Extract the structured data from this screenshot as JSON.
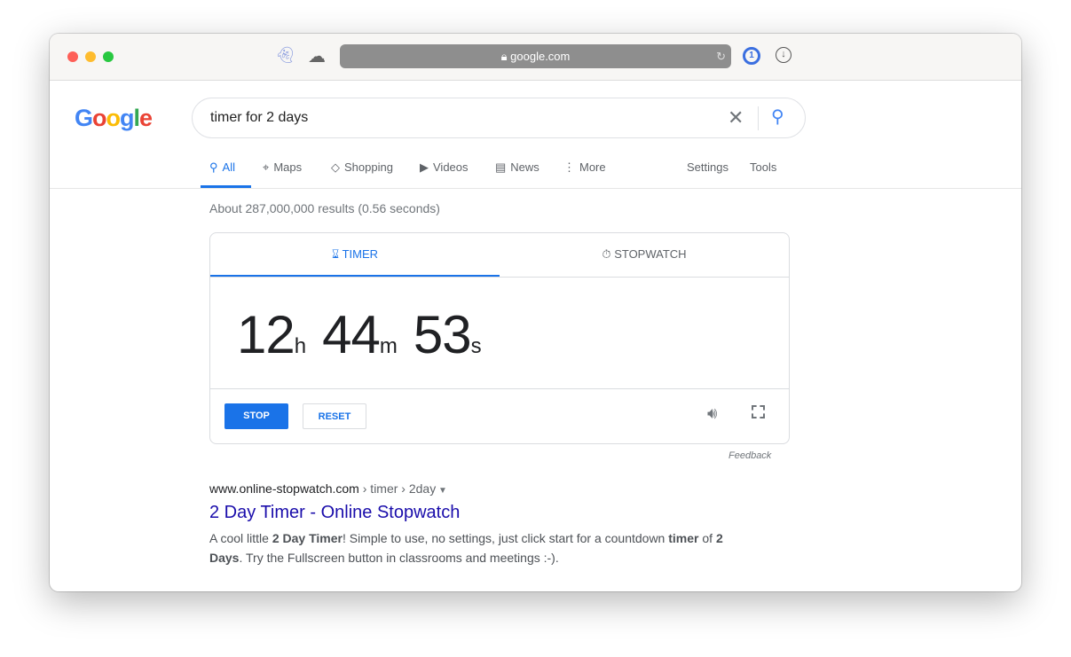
{
  "browser": {
    "url": "google.com",
    "extensions": [
      "ghost-icon",
      "cloud-icon",
      "1password-icon",
      "download-icon"
    ]
  },
  "logo": {
    "text": "Google"
  },
  "search": {
    "query": "timer for 2 days"
  },
  "nav": {
    "tabs": [
      {
        "label": "All",
        "icon": "search-icon"
      },
      {
        "label": "Maps",
        "icon": "pin-icon"
      },
      {
        "label": "Shopping",
        "icon": "tag-icon"
      },
      {
        "label": "Videos",
        "icon": "play-icon"
      },
      {
        "label": "News",
        "icon": "news-icon"
      },
      {
        "label": "More",
        "icon": "more-icon"
      }
    ],
    "settings": "Settings",
    "tools": "Tools"
  },
  "stats": "About 287,000,000 results (0.56 seconds)",
  "timer": {
    "tabs": [
      "TIMER",
      "STOPWATCH"
    ],
    "hours": "12",
    "h": "h",
    "minutes": "44",
    "m": "m",
    "seconds": "53",
    "s": "s",
    "stop": "STOP",
    "reset": "RESET",
    "feedback": "Feedback"
  },
  "result": {
    "cite": "www.online-stopwatch.com",
    "path": " › timer › 2day",
    "title": "2 Day Timer - Online Stopwatch",
    "snippet": [
      {
        "t": "A cool little ",
        "b": false
      },
      {
        "t": "2 Day Timer",
        "b": true
      },
      {
        "t": "! Simple to use, no settings, just click start for a countdown ",
        "b": false
      },
      {
        "t": "timer",
        "b": true
      },
      {
        "t": " of ",
        "b": false
      },
      {
        "t": "2 Days",
        "b": true
      },
      {
        "t": ". Try the Fullscreen button in classrooms and meetings :-).",
        "b": false
      }
    ]
  },
  "colors": {
    "accent": "#1a73e8",
    "link": "#1a0dab"
  }
}
